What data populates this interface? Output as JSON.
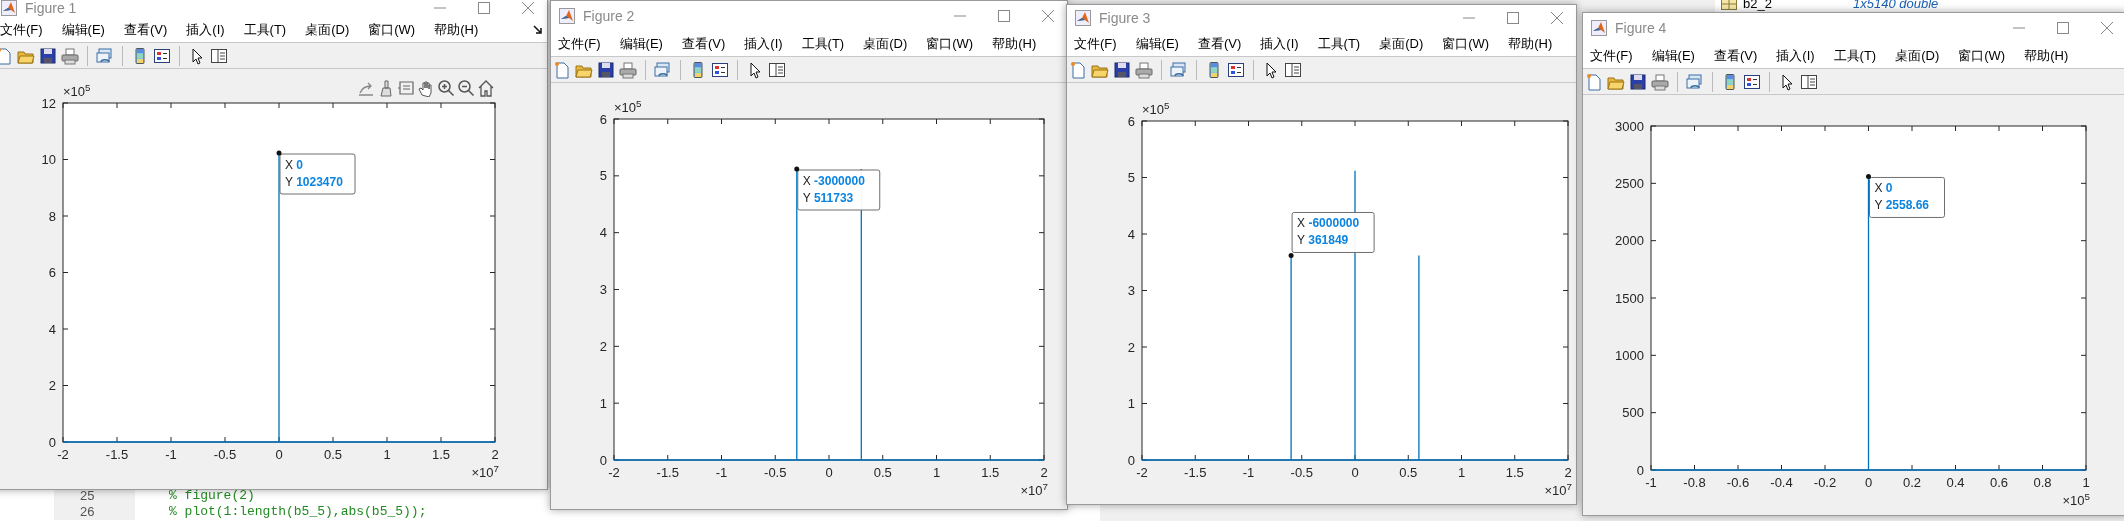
{
  "background": {
    "workspace_rows": [
      {
        "name": "b2_2",
        "value": "1x5140 double"
      }
    ],
    "editor_lines": [
      {
        "number": "25",
        "code": "% figure(2)"
      },
      {
        "number": "26",
        "code": "% plot(1:length(b5_5),abs(b5_5));"
      }
    ]
  },
  "figures": [
    {
      "title": "Figure 1",
      "menu": [
        "文件(F)",
        "编辑(E)",
        "查看(V)",
        "插入(I)",
        "工具(T)",
        "桌面(D)",
        "窗口(W)",
        "帮助(H)"
      ],
      "dock_button": true,
      "axes_toolbar": true,
      "y_multiplier": "×10$^{5}$",
      "x_multiplier": "×10$^{7}$",
      "chart_data": {
        "type": "line",
        "x": [
          -2,
          0,
          0,
          0,
          2
        ],
        "series": [
          {
            "color": "#0072bd",
            "values": [
              0,
              0,
              10.23,
              0,
              0
            ]
          }
        ],
        "xlim": [
          -2,
          2
        ],
        "ylim": [
          0,
          12
        ],
        "xticks": [
          -2,
          -1.5,
          -1,
          -0.5,
          0,
          0.5,
          1,
          1.5,
          2
        ],
        "yticks": [
          0,
          2,
          4,
          6,
          8,
          10,
          12
        ],
        "annotations": [
          {
            "x": 0,
            "y": 10.23,
            "text": "X 0"
          },
          {
            "x": 0,
            "y": 10.23,
            "text": "Y 1023470"
          }
        ]
      }
    },
    {
      "title": "Figure 2",
      "menu": [
        "文件(F)",
        "编辑(E)",
        "查看(V)",
        "插入(I)",
        "工具(T)",
        "桌面(D)",
        "窗口(W)",
        "帮助(H)"
      ],
      "axes_toolbar": false,
      "y_multiplier": "×10$^{5}$",
      "x_multiplier": "×10$^{7}$",
      "chart_data": {
        "type": "line",
        "x": [
          -2,
          -0.3,
          -0.3,
          -0.3,
          0.3,
          0.3,
          0.3,
          2
        ],
        "series": [
          {
            "color": "#0072bd",
            "values": [
              0,
              0,
              5.12,
              0,
              0,
              5.12,
              0,
              0
            ]
          }
        ],
        "xlim": [
          -2,
          2
        ],
        "ylim": [
          0,
          6
        ],
        "xticks": [
          -2,
          -1.5,
          -1,
          -0.5,
          0,
          0.5,
          1,
          1.5,
          2
        ],
        "yticks": [
          0,
          1,
          2,
          3,
          4,
          5,
          6
        ],
        "annotations": [
          {
            "x": -0.3,
            "y": 5.12,
            "text": "X -3000000"
          },
          {
            "x": -0.3,
            "y": 5.12,
            "text": "Y 511733"
          }
        ]
      }
    },
    {
      "title": "Figure 3",
      "menu": [
        "文件(F)",
        "编辑(E)",
        "查看(V)",
        "插入(I)",
        "工具(T)",
        "桌面(D)",
        "窗口(W)",
        "帮助(H)"
      ],
      "axes_toolbar": false,
      "y_multiplier": "×10$^{5}$",
      "x_multiplier": "×10$^{7}$",
      "chart_data": {
        "type": "line",
        "x": [
          -2,
          -0.6,
          -0.6,
          -0.6,
          0,
          0,
          0,
          0.6,
          0.6,
          0.6,
          2
        ],
        "series": [
          {
            "color": "#0072bd",
            "values": [
              0,
              0,
              3.62,
              0,
              0,
              5.12,
              0,
              0,
              3.62,
              0,
              0
            ]
          }
        ],
        "xlim": [
          -2,
          2
        ],
        "ylim": [
          0,
          6
        ],
        "xticks": [
          -2,
          -1.5,
          -1,
          -0.5,
          0,
          0.5,
          1,
          1.5,
          2
        ],
        "yticks": [
          0,
          1,
          2,
          3,
          4,
          5,
          6
        ],
        "annotations": [
          {
            "x": -0.6,
            "y": 3.62,
            "text": "X -6000000"
          },
          {
            "x": -0.6,
            "y": 3.62,
            "text": "Y 361849"
          }
        ]
      }
    },
    {
      "title": "Figure 4",
      "menu": [
        "文件(F)",
        "编辑(E)",
        "查看(V)",
        "插入(I)",
        "工具(T)",
        "桌面(D)",
        "窗口(W)",
        "帮助(H)"
      ],
      "axes_toolbar": false,
      "x_multiplier": "×10$^{5}$",
      "chart_data": {
        "type": "line",
        "x": [
          -1,
          0,
          0,
          0,
          1
        ],
        "series": [
          {
            "color": "#0072bd",
            "values": [
              0,
              0,
              2560,
              0,
              0
            ]
          }
        ],
        "xlim": [
          -1,
          1
        ],
        "ylim": [
          0,
          3000
        ],
        "xticks": [
          -1,
          -0.8,
          -0.6,
          -0.4,
          -0.2,
          0,
          0.2,
          0.4,
          0.6,
          0.8,
          1
        ],
        "yticks": [
          0,
          500,
          1000,
          1500,
          2000,
          2500,
          3000
        ],
        "annotations": [
          {
            "x": 0,
            "y": 2560,
            "text": "X 0"
          },
          {
            "x": 0,
            "y": 2560,
            "text": "Y 2558.66"
          }
        ]
      }
    }
  ]
}
